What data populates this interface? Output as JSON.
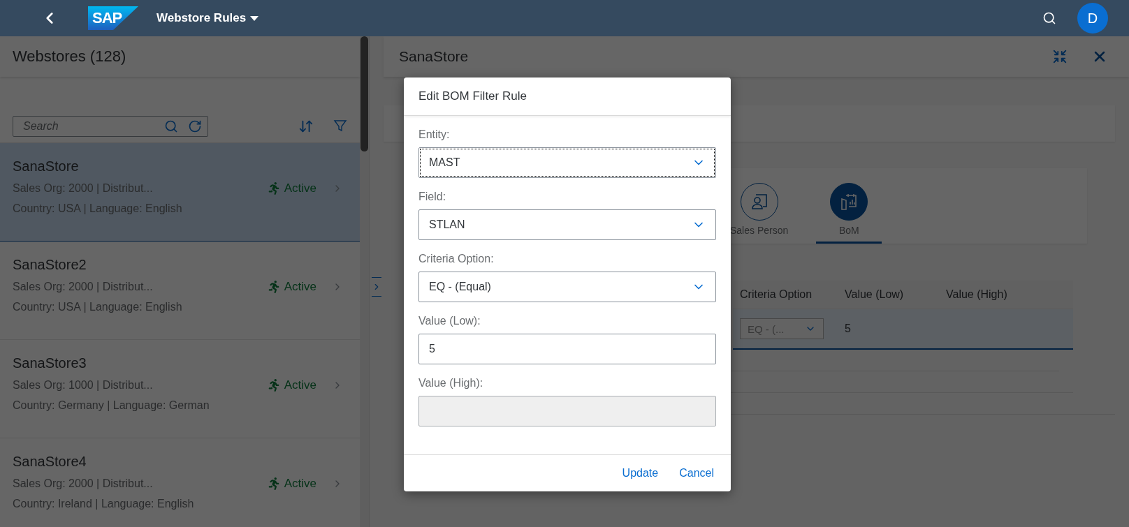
{
  "shell": {
    "logo": "SAP",
    "title": "Webstore Rules",
    "avatar": "D"
  },
  "master": {
    "title": "Webstores (128)",
    "search": {
      "placeholder": "Search"
    },
    "items": [
      {
        "name": "SanaStore",
        "line1": "Sales Org: 2000 | Distribut...",
        "line2": "Country: USA | Language: English",
        "status": "Active",
        "selected": true
      },
      {
        "name": "SanaStore2",
        "line1": "Sales Org: 2000 | Distribut...",
        "line2": "Country: USA | Language: English",
        "status": "Active",
        "selected": false
      },
      {
        "name": "SanaStore3",
        "line1": "Sales Org: 1000 | Distribut...",
        "line2": "Country: Germany | Language: German",
        "status": "Active",
        "selected": false
      },
      {
        "name": "SanaStore4",
        "line1": "Sales Org: 2000 | Distribut...",
        "line2": "Country: Ireland | Language: English",
        "status": "Active",
        "selected": false
      }
    ]
  },
  "detail": {
    "title": "SanaStore",
    "tabs": [
      {
        "label": "Sales Person",
        "kind": "person",
        "selected": false
      },
      {
        "label": "BoM",
        "kind": "bom",
        "selected": true
      }
    ],
    "table": {
      "columns": [
        "Criteria Option",
        "Value (Low)",
        "Value (High)"
      ],
      "rows": [
        {
          "criteria_option": "EQ - (...",
          "value_low": "5",
          "selected": true
        }
      ]
    }
  },
  "dialog": {
    "title": "Edit BOM Filter Rule",
    "fields": [
      {
        "label": "Entity:",
        "kind": "select",
        "value": "MAST",
        "focused": true,
        "disabled": false
      },
      {
        "label": "Field:",
        "kind": "select",
        "value": "STLAN",
        "focused": false,
        "disabled": false
      },
      {
        "label": "Criteria Option:",
        "kind": "select",
        "value": "EQ - (Equal)",
        "focused": false,
        "disabled": false
      },
      {
        "label": "Value (Low):",
        "kind": "input",
        "value": "5",
        "focused": false,
        "disabled": false
      },
      {
        "label": "Value (High):",
        "kind": "input",
        "focused": false,
        "disabled": true
      }
    ],
    "buttons": [
      "Update",
      "Cancel"
    ]
  }
}
